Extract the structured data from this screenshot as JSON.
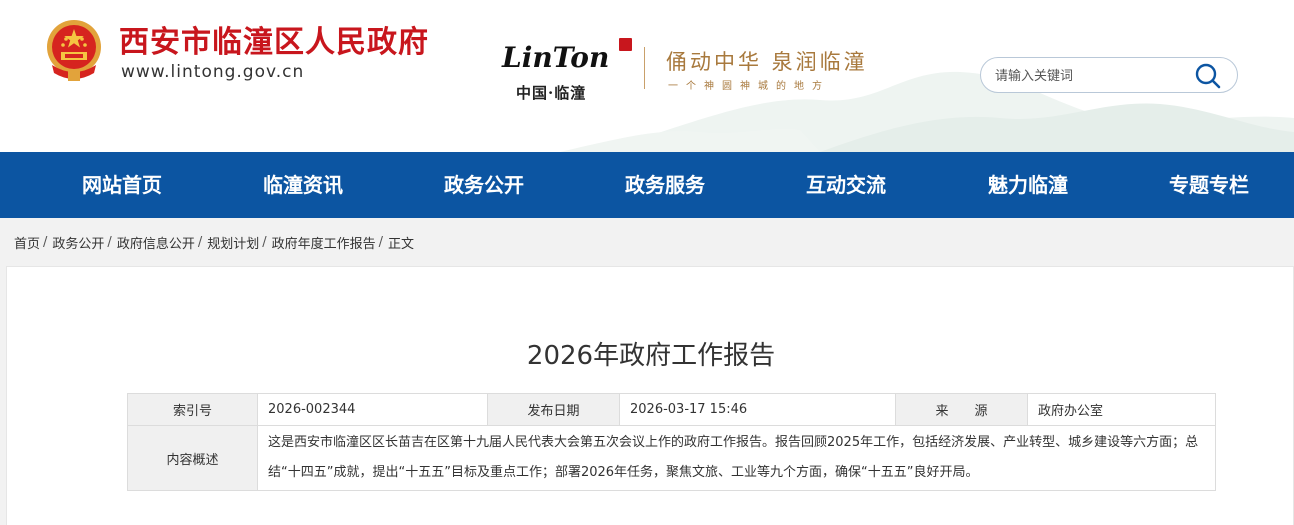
{
  "header": {
    "site_title": "西安市临潼区人民政府",
    "site_domain": "www.lintong.gov.cn",
    "brand_logo_text": "LinTong",
    "brand_cn": "中国·临潼",
    "slogan": "俑动中华 泉润临潼",
    "slogan_sub": "一个神圆神城的地方",
    "colors": {
      "title_red": "#c8161d",
      "gold": "#a8793d"
    }
  },
  "search": {
    "placeholder": "请输入关键词",
    "value": "",
    "icon": "search-icon"
  },
  "nav": {
    "background": "#0c55a2",
    "items": [
      {
        "label": "网站首页"
      },
      {
        "label": "临潼资讯"
      },
      {
        "label": "政务公开"
      },
      {
        "label": "政务服务"
      },
      {
        "label": "互动交流"
      },
      {
        "label": "魅力临潼"
      },
      {
        "label": "专题专栏"
      }
    ]
  },
  "breadcrumb": {
    "items": [
      {
        "label": "首页"
      },
      {
        "label": "政务公开"
      },
      {
        "label": "政府信息公开"
      },
      {
        "label": "规划计划"
      },
      {
        "label": "政府年度工作报告"
      }
    ],
    "separator": "/",
    "current": "正文"
  },
  "article": {
    "title": "2026年政府工作报告",
    "meta": {
      "index_label": "索引号",
      "index_value": "2026-002344",
      "date_label": "发布日期",
      "date_value": "2026-03-17 15:46",
      "source_label": "来　　源",
      "source_value": "政府办公室",
      "summary_label": "内容概述",
      "summary_value": "这是西安市临潼区区长苗吉在区第十九届人民代表大会第五次会议上作的政府工作报告。报告回顾2025年工作，包括经济发展、产业转型、城乡建设等六方面；总结“十四五”成就，提出“十五五”目标及重点工作；部署2026年任务，聚焦文旅、工业等九个方面，确保“十五五”良好开局。"
    }
  }
}
